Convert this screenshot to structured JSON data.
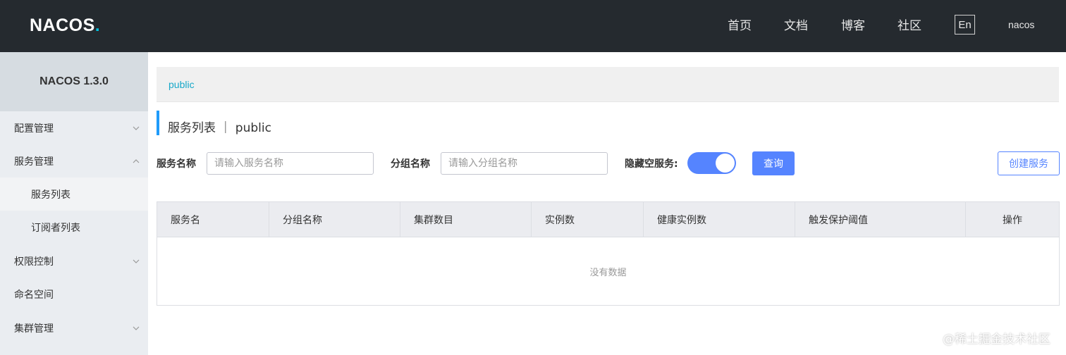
{
  "header": {
    "logo_text": "NACOS",
    "logo_dot": ".",
    "nav": [
      "首页",
      "文档",
      "博客",
      "社区"
    ],
    "lang": "En",
    "user": "nacos"
  },
  "sidebar": {
    "version": "NACOS 1.3.0",
    "items": [
      {
        "label": "配置管理",
        "chevron": "down"
      },
      {
        "label": "服务管理",
        "chevron": "up"
      },
      {
        "label": "服务列表",
        "sub": true,
        "active": true
      },
      {
        "label": "订阅者列表",
        "sub": true
      },
      {
        "label": "权限控制",
        "chevron": "down"
      },
      {
        "label": "命名空间"
      },
      {
        "label": "集群管理",
        "chevron": "down"
      }
    ]
  },
  "main": {
    "namespace_link": "public",
    "title": "服务列表 ｜ public",
    "filters": {
      "service_name_label": "服务名称",
      "service_name_placeholder": "请输入服务名称",
      "group_name_label": "分组名称",
      "group_name_placeholder": "请输入分组名称",
      "hide_empty_label": "隐藏空服务:",
      "hide_empty_on": true
    },
    "query_button": "查询",
    "create_button": "创建服务",
    "table": {
      "columns": [
        "服务名",
        "分组名称",
        "集群数目",
        "实例数",
        "健康实例数",
        "触发保护阈值",
        "操作"
      ],
      "empty_text": "没有数据"
    }
  },
  "watermark": "@稀土掘金技术社区",
  "colors": {
    "header_bg": "#252a2f",
    "accent": "#5584ff",
    "link": "#17a8c9"
  }
}
